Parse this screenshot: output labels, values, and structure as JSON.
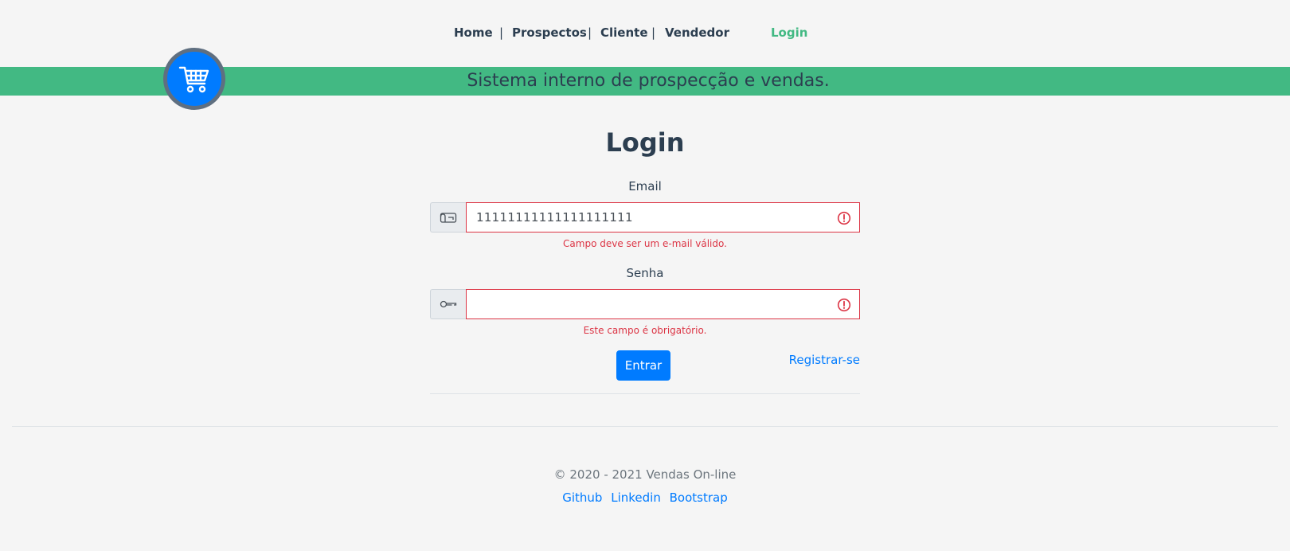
{
  "nav": {
    "home": "Home",
    "prospectos": "Prospectos",
    "cliente": "Cliente",
    "vendedor": "Vendedor",
    "login": "Login",
    "separator": "|"
  },
  "banner": {
    "text": "Sistema interno de prospecção e vendas."
  },
  "logo": {
    "icon": "shopping-cart-icon"
  },
  "form": {
    "title": "Login",
    "email_label": "Email",
    "email_value": "11111111111111111111",
    "email_error": "Campo deve ser um e-mail válido.",
    "password_label": "Senha",
    "password_value": "",
    "password_error": "Este campo é obrigatório.",
    "submit_label": "Entrar",
    "register_link": "Registrar-se"
  },
  "footer": {
    "copyright": "© 2020 - 2021 Vendas On-line",
    "links": [
      "Github",
      "Linkedin",
      "Bootstrap"
    ]
  },
  "colors": {
    "accent_green": "#42b983",
    "primary_blue": "#007bff",
    "error_red": "#dc3545",
    "text_dark": "#2c3e50"
  }
}
